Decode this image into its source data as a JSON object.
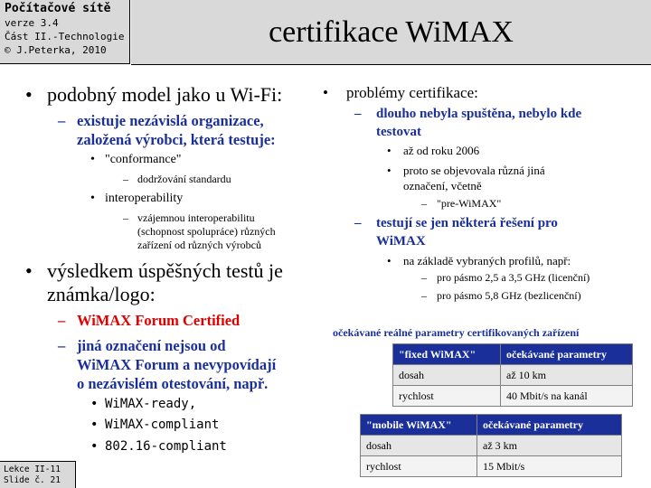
{
  "header": {
    "course": "Počítačové sítě",
    "version": "verze 3.4",
    "part": "Část II.-Technologie",
    "author": "© J.Peterka, 2010"
  },
  "title": "certifikace WiMAX",
  "footer": {
    "lesson": "Lekce II-11",
    "slide": "Slide č. 21"
  },
  "left": {
    "b1": "podobný model jako u Wi-Fi:",
    "b1_s1_a": "existuje nezávislá organizace,",
    "b1_s1_b": "založená výrobci, která testuje:",
    "b1_s1_i1": "\"conformance\"",
    "b1_s1_i1_a": "dodržování standardu",
    "b1_s1_i2": "interoperability",
    "b1_s1_i2_a": "vzájemnou interoperabilitu",
    "b1_s1_i2_b": "(schopnost spolupráce) různých",
    "b1_s1_i2_c": "zařízení od různých výrobců",
    "b2_a": "výsledkem úspěšných testů je",
    "b2_b": "známka/logo:",
    "b2_s1": "WiMAX Forum Certified",
    "b2_s2_a": "jiná označení nejsou od",
    "b2_s2_b": "WiMAX Forum a nevypovídají",
    "b2_s2_c": "o nezávislém otestování, např.",
    "b2_s2_i1": "WiMAX-ready,",
    "b2_s2_i2": "WiMAX-compliant",
    "b2_s2_i3": "802.16-compliant"
  },
  "right": {
    "b1": "problémy certifikace:",
    "b1_s1_a": "dlouho nebyla spuštěna, nebylo kde",
    "b1_s1_b": "testovat",
    "b1_s1_i1": "až od roku 2006",
    "b1_s1_i2_a": "proto se objevovala různá jiná",
    "b1_s1_i2_b": "označení, včetně",
    "b1_s1_i2_sub": "\"pre-WiMAX\"",
    "b1_s2_a": "testují se jen některá řešení pro",
    "b1_s2_b": "WiMAX",
    "b1_s2_i1": "na základě vybraných profilů, např:",
    "b1_s2_i1_a": "pro pásmo 2,5 a 3,5 GHz (licenční)",
    "b1_s2_i1_b": "pro pásmo 5,8 GHz (bezlicenční)"
  },
  "table_caption": "očekávané reálné parametry certifikovaných zařízení",
  "fixed_table": {
    "head": [
      "\"fixed WiMAX\"",
      "očekávané parametry"
    ],
    "rows": [
      [
        "dosah",
        "až 10 km"
      ],
      [
        "rychlost",
        "40 Mbit/s na kanál"
      ]
    ]
  },
  "mobile_table": {
    "head": [
      "\"mobile WiMAX\"",
      "očekávané parametry"
    ],
    "rows": [
      [
        "dosah",
        "až 3 km"
      ],
      [
        "rychlost",
        "15 Mbit/s"
      ]
    ]
  },
  "colors": {
    "accent": "#1a2f99",
    "highlight": "#e00000",
    "panel": "#d9d9d9"
  },
  "bullets": {
    "level1": "•",
    "level2": "–",
    "level3": "•",
    "level4": "–"
  }
}
